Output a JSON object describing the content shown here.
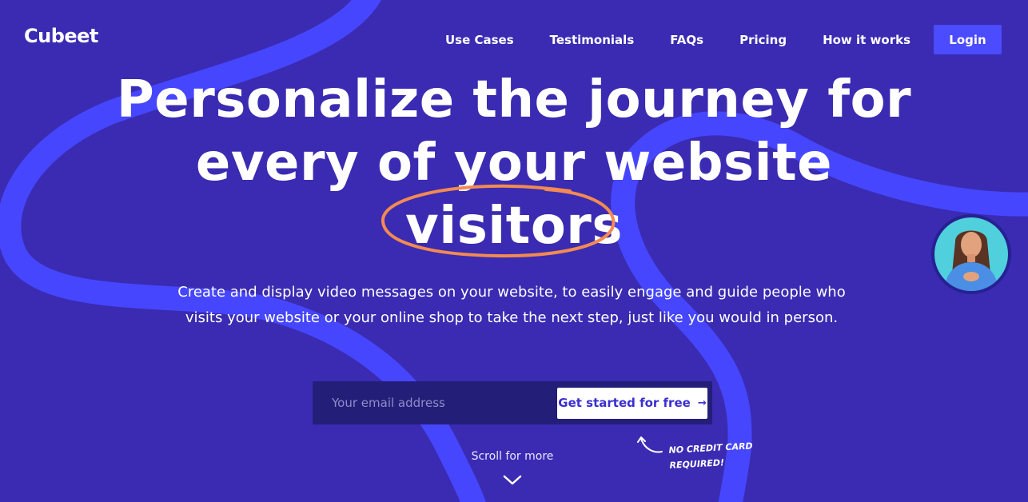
{
  "brand": {
    "name": "Cubeet"
  },
  "nav": {
    "items": [
      {
        "label": "Use Cases"
      },
      {
        "label": "Testimonials"
      },
      {
        "label": "FAQs"
      },
      {
        "label": "Pricing"
      },
      {
        "label": "How it works"
      }
    ],
    "login_label": "Login"
  },
  "hero": {
    "line1": "Personalize the journey for",
    "line2": "every of your website",
    "highlight": "visitors",
    "subtext": "Create and display video messages on your website, to easily engage and guide people who visits your website or your online shop to take the next step, just like you would in person."
  },
  "signup": {
    "email_placeholder": "Your email address",
    "cta_label": "Get started for free",
    "cta_arrow": "→"
  },
  "note": {
    "line1": "NO CREDIT CARD",
    "line2": "REQUIRED!"
  },
  "scroll": {
    "label": "Scroll for more"
  },
  "colors": {
    "background": "#3a2bb2",
    "swirl": "#4b4bff",
    "accent_button": "#4b4bff",
    "circle_highlight": "#f28a52",
    "signup_bar": "#231f78",
    "cta_text": "#3b2fd0"
  },
  "icons": {
    "cta": "arrow-right-icon",
    "note": "curved-arrow-icon",
    "scroll": "chevron-down-icon"
  }
}
